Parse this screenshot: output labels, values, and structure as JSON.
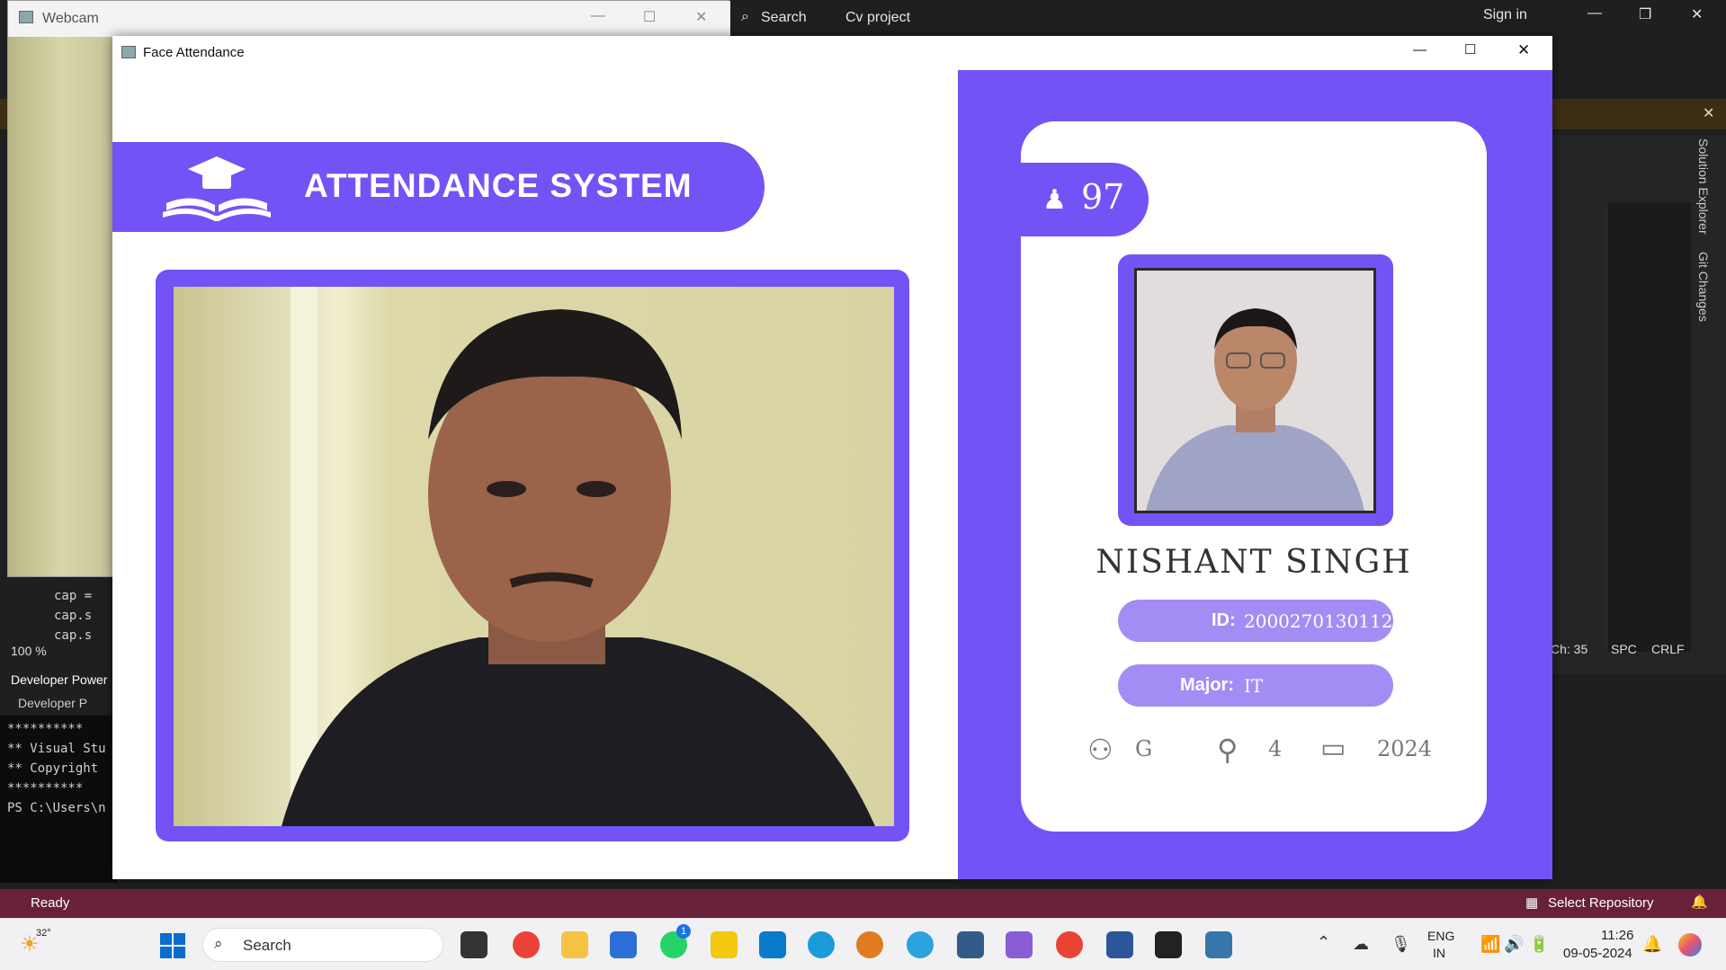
{
  "webcam_window": {
    "title": "Webcam"
  },
  "vs": {
    "search_label": "Search",
    "project_name": "Cv project",
    "sign_in": "Sign in",
    "status": "Ready",
    "repo": "Select Repository",
    "zoom": "100 %",
    "position": "Ch: 35",
    "spc": "SPC",
    "crlf": "CRLF",
    "code_lines": [
      "cap =",
      "cap.s",
      "cap.s"
    ],
    "terminal_title": "Developer Power",
    "terminal_tab": "Developer P",
    "terminal_lines": [
      "**********",
      "** Visual Stu",
      "** Copyright",
      "**********",
      "PS C:\\Users\\n"
    ],
    "side_tabs": [
      "Solution Explorer",
      "Git Changes"
    ]
  },
  "app": {
    "window_title": "Face Attendance",
    "banner_title": "ATTENDANCE SYSTEM",
    "student": {
      "attendance_count": "97",
      "name": "NISHANT SINGH",
      "id_label": "ID:",
      "id_value": "2000270130112",
      "major_label": "Major:",
      "major_value": "IT",
      "standing": "G",
      "year": "4",
      "starting_year": "2024"
    }
  },
  "taskbar": {
    "weather": "32°",
    "search_placeholder": "Search",
    "lang_top": "ENG",
    "lang_bottom": "IN",
    "time": "11:26",
    "date": "09-05-2024",
    "whatsapp_badge": "1"
  }
}
